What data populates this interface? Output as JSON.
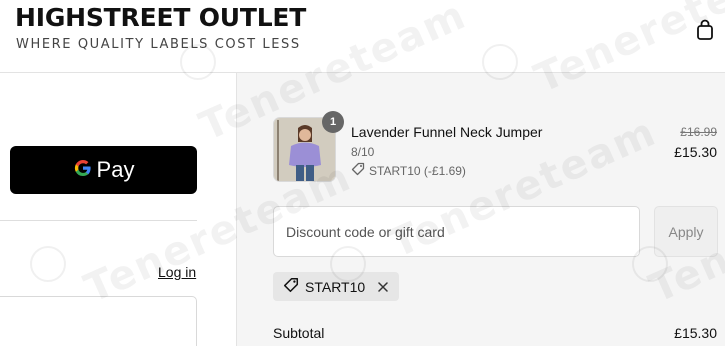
{
  "header": {
    "brand_name": "HIGHSTREET OUTLET",
    "tagline": "WHERE QUALITY LABELS COST LESS",
    "cart_icon": "shopping-bag-icon"
  },
  "express": {
    "gpay_label": "Pay",
    "google_g_icon": "google-g-icon"
  },
  "contact": {
    "login_label": "Log in"
  },
  "order": {
    "item": {
      "quantity": "1",
      "name": "Lavender Funnel Neck Jumper",
      "variant": "8/10",
      "discount": "START10 (-£1.69)",
      "original_price": "£16.99",
      "price": "£15.30"
    },
    "discount_field": {
      "placeholder": "Discount code or gift card"
    },
    "apply_label": "Apply",
    "applied_code": "START10",
    "subtotal_label": "Subtotal",
    "subtotal_value": "£15.30"
  },
  "watermark": {
    "text": "Tenereteam"
  },
  "colors": {
    "gpay_background": "#000000",
    "summary_background": "#f5f5f5",
    "product_sweater": "#9b8fd6"
  }
}
